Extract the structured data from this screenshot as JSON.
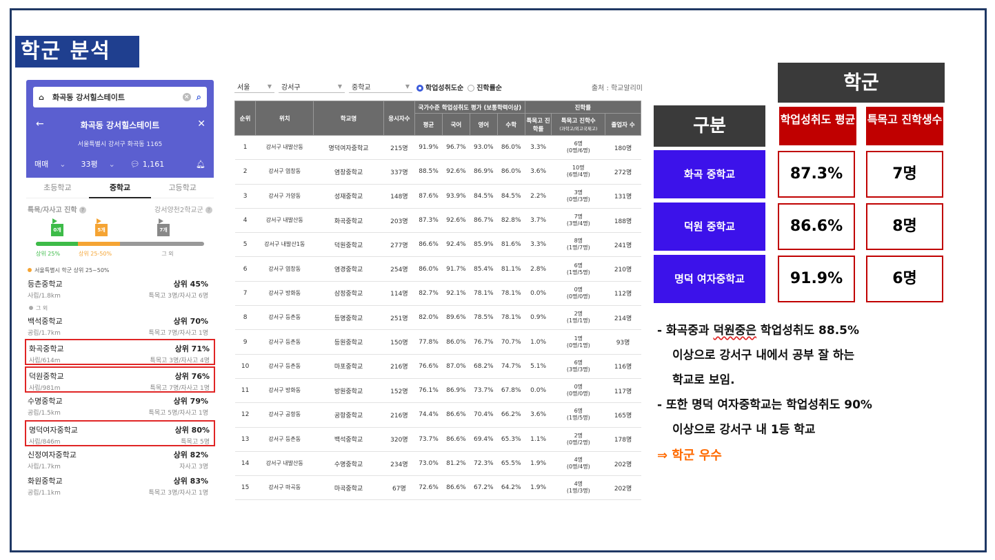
{
  "page_title": "학군 분석",
  "app": {
    "search_text": "화곡동 강서힐스테이트",
    "apt_name": "화곡동 강서힐스테이트",
    "address": "서울특별시 강서구 화곡동 1165",
    "trade_type": "매매",
    "size": "33평",
    "count": "1,161",
    "tabs": [
      "초등학교",
      "중학교",
      "고등학교"
    ],
    "section_title": "특목/자사고 진학",
    "section_side": "강서양천2학교군",
    "flags": [
      "0개",
      "5개",
      "7개"
    ],
    "progress": {
      "green_pct": 25,
      "orange_pct": 25
    },
    "progress_labels": [
      "상위 25%",
      "상위 25-50%",
      "그 외"
    ],
    "legend_text": "서울특별시 학군 상위 25~50%",
    "group_other": "그 외",
    "schools": [
      {
        "name": "등촌중학교",
        "rank": "상위 45%",
        "type": "사립/1.8km",
        "extra": "특목고 3명/자사고 6명"
      },
      {
        "name": "백석중학교",
        "rank": "상위 70%",
        "type": "공립/1.7km",
        "extra": "특목고 7명/자사고 1명"
      },
      {
        "name": "화곡중학교",
        "rank": "상위 71%",
        "type": "사립/614m",
        "extra": "특목고 3명/자사고 4명"
      },
      {
        "name": "덕원중학교",
        "rank": "상위 76%",
        "type": "사립/981m",
        "extra": "특목고 7명/자사고 1명"
      },
      {
        "name": "수명중학교",
        "rank": "상위 79%",
        "type": "공립/1.5km",
        "extra": "특목고 5명/자사고 1명"
      },
      {
        "name": "명덕여자중학교",
        "rank": "상위 80%",
        "type": "사립/846m",
        "extra": "특목고 5명"
      },
      {
        "name": "신정여자중학교",
        "rank": "상위 82%",
        "type": "사립/1.7km",
        "extra": "자사고 3명"
      },
      {
        "name": "화원중학교",
        "rank": "상위 83%",
        "type": "공립/1.1km",
        "extra": "특목고 3명/자사고 1명"
      }
    ]
  },
  "filters": {
    "city": "서울",
    "district": "강서구",
    "level": "중학교",
    "sort_opt1": "학업성취도순",
    "sort_opt2": "진학률순",
    "source": "출처 : 학교알리미"
  },
  "table": {
    "headers": {
      "rank": "순위",
      "location": "위치",
      "school": "학교명",
      "applicants": "응시자수",
      "group_eval": "국가수준 학업성취도 평가 (보통학력이상)",
      "avg": "평균",
      "kor": "국어",
      "eng": "영어",
      "math": "수학",
      "group_adv": "진학률",
      "special_rate": "특목고 진학률",
      "special_count": "특목고 진학수",
      "special_count_sub": "(과학고/외고국제고)",
      "grads": "졸업자 수"
    },
    "rows": [
      {
        "rank": "1",
        "loc": "강서구 내발산동",
        "name": "명덕여자중학교",
        "n": "215명",
        "avg": "91.9%",
        "kor": "96.7%",
        "eng": "93.0%",
        "math": "86.0%",
        "rate": "3.3%",
        "cnt": "6명",
        "cnt2": "(0명/6명)",
        "grad": "180명"
      },
      {
        "rank": "2",
        "loc": "강서구 염창동",
        "name": "염창중학교",
        "n": "337명",
        "avg": "88.5%",
        "kor": "92.6%",
        "eng": "86.9%",
        "math": "86.0%",
        "rate": "3.6%",
        "cnt": "10명",
        "cnt2": "(6명/4명)",
        "grad": "272명"
      },
      {
        "rank": "3",
        "loc": "강서구 가양동",
        "name": "성재중학교",
        "n": "148명",
        "avg": "87.6%",
        "kor": "93.9%",
        "eng": "84.5%",
        "math": "84.5%",
        "rate": "2.2%",
        "cnt": "3명",
        "cnt2": "(0명/3명)",
        "grad": "131명"
      },
      {
        "rank": "4",
        "loc": "강서구 내발산동",
        "name": "화곡중학교",
        "n": "203명",
        "avg": "87.3%",
        "kor": "92.6%",
        "eng": "86.7%",
        "math": "82.8%",
        "rate": "3.7%",
        "cnt": "7명",
        "cnt2": "(3명/4명)",
        "grad": "188명"
      },
      {
        "rank": "5",
        "loc": "강서구 내발산1동",
        "name": "덕원중학교",
        "n": "277명",
        "avg": "86.6%",
        "kor": "92.4%",
        "eng": "85.9%",
        "math": "81.6%",
        "rate": "3.3%",
        "cnt": "8명",
        "cnt2": "(1명/7명)",
        "grad": "241명"
      },
      {
        "rank": "6",
        "loc": "강서구 염창동",
        "name": "염경중학교",
        "n": "254명",
        "avg": "86.0%",
        "kor": "91.7%",
        "eng": "85.4%",
        "math": "81.1%",
        "rate": "2.8%",
        "cnt": "6명",
        "cnt2": "(1명/5명)",
        "grad": "210명"
      },
      {
        "rank": "7",
        "loc": "강서구 방화동",
        "name": "삼정중학교",
        "n": "114명",
        "avg": "82.7%",
        "kor": "92.1%",
        "eng": "78.1%",
        "math": "78.1%",
        "rate": "0.0%",
        "cnt": "0명",
        "cnt2": "(0명/0명)",
        "grad": "112명"
      },
      {
        "rank": "8",
        "loc": "강서구 등촌동",
        "name": "등명중학교",
        "n": "251명",
        "avg": "82.0%",
        "kor": "89.6%",
        "eng": "78.5%",
        "math": "78.1%",
        "rate": "0.9%",
        "cnt": "2명",
        "cnt2": "(1명/1명)",
        "grad": "214명"
      },
      {
        "rank": "9",
        "loc": "강서구 등촌동",
        "name": "등원중학교",
        "n": "150명",
        "avg": "77.8%",
        "kor": "86.0%",
        "eng": "76.7%",
        "math": "70.7%",
        "rate": "1.0%",
        "cnt": "1명",
        "cnt2": "(0명/1명)",
        "grad": "93명"
      },
      {
        "rank": "10",
        "loc": "강서구 등촌동",
        "name": "마포중학교",
        "n": "216명",
        "avg": "76.6%",
        "kor": "87.0%",
        "eng": "68.2%",
        "math": "74.7%",
        "rate": "5.1%",
        "cnt": "6명",
        "cnt2": "(3명/3명)",
        "grad": "116명"
      },
      {
        "rank": "11",
        "loc": "강서구 방화동",
        "name": "방원중학교",
        "n": "152명",
        "avg": "76.1%",
        "kor": "86.9%",
        "eng": "73.7%",
        "math": "67.8%",
        "rate": "0.0%",
        "cnt": "0명",
        "cnt2": "(0명/0명)",
        "grad": "117명"
      },
      {
        "rank": "12",
        "loc": "강서구 공항동",
        "name": "공항중학교",
        "n": "216명",
        "avg": "74.4%",
        "kor": "86.6%",
        "eng": "70.4%",
        "math": "66.2%",
        "rate": "3.6%",
        "cnt": "6명",
        "cnt2": "(1명/5명)",
        "grad": "165명"
      },
      {
        "rank": "13",
        "loc": "강서구 등촌동",
        "name": "백석중학교",
        "n": "320명",
        "avg": "73.7%",
        "kor": "86.6%",
        "eng": "69.4%",
        "math": "65.3%",
        "rate": "1.1%",
        "cnt": "2명",
        "cnt2": "(0명/2명)",
        "grad": "178명"
      },
      {
        "rank": "14",
        "loc": "강서구 내발산동",
        "name": "수명중학교",
        "n": "234명",
        "avg": "73.0%",
        "kor": "81.2%",
        "eng": "72.3%",
        "math": "65.5%",
        "rate": "1.9%",
        "cnt": "4명",
        "cnt2": "(0명/4명)",
        "grad": "202명"
      },
      {
        "rank": "15",
        "loc": "강서구 마곡동",
        "name": "마곡중학교",
        "n": "67명",
        "avg": "72.6%",
        "kor": "86.6%",
        "eng": "67.2%",
        "math": "64.2%",
        "rate": "1.9%",
        "cnt": "4명",
        "cnt2": "(1명/3명)",
        "grad": "202명"
      }
    ]
  },
  "compare": {
    "title": "학군",
    "category": "구분",
    "col1": "학업성취도 평균",
    "col2": "특목고 진학생수",
    "rows": [
      {
        "name": "화곡 중학교",
        "avg": "87.3%",
        "count": "7명"
      },
      {
        "name": "덕원 중학교",
        "avg": "86.6%",
        "count": "8명"
      },
      {
        "name": "명덕 여자중학교",
        "avg": "91.9%",
        "count": "6명"
      }
    ]
  },
  "notes": {
    "line1_a": "- 화곡중과 ",
    "line1_b": "덕원중은",
    "line1_c": " 학업성취도 88.5%",
    "line2": "이상으로 강서구 내에서 공부 잘 하는",
    "line3": "학교로 보임.",
    "line4": "- 또한 명덕 여자중학교는 학업성취도 90%",
    "line5": "이상으로 강서구 내 1등 학교",
    "conclusion": "⇒ 학군 우수"
  },
  "colors": {
    "title_bg": "#1f3f8f",
    "hero": "#5b5fd0",
    "highlight": "#e02424",
    "accent_red": "#c00000",
    "purple": "#3c12ea",
    "orange": "#ff6a00"
  }
}
